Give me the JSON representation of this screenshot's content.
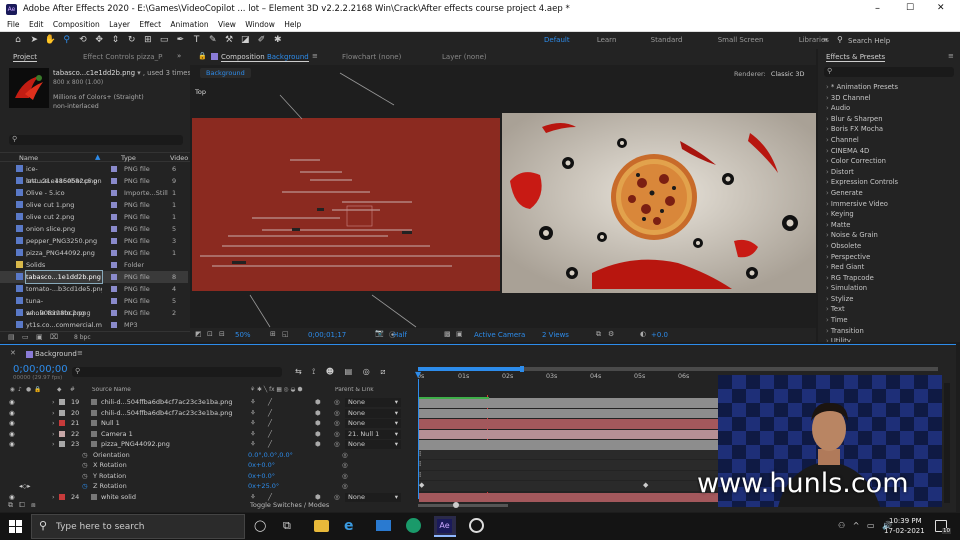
{
  "window": {
    "title": "Adobe After Effects 2020 - E:\\Games\\VideoCopilot ... lot – Element 3D v2.2.2.2168 Win\\Crack\\After effects course project 4.aep *",
    "controls": [
      "–",
      "☐",
      "✕"
    ]
  },
  "menu": [
    "File",
    "Edit",
    "Composition",
    "Layer",
    "Effect",
    "Animation",
    "View",
    "Window",
    "Help"
  ],
  "workspaces": {
    "items": [
      "Default",
      "Learn",
      "Standard",
      "Small Screen",
      "Libraries"
    ],
    "active": "Default",
    "more": "»",
    "search_placeholder": "Search Help"
  },
  "project_panel": {
    "tab": "Project",
    "effect_controls_tab": "Effect Controls pizza_PNG",
    "selected_name": "tabasco...c1e1dd2b.png",
    "used": ", used 3 times",
    "dims": "800 x 800 (1.00)",
    "colors": "Millions of Colors+ (Straight)",
    "interlace": "non-interlaced",
    "columns": {
      "name": "Name",
      "type": "Type",
      "video": "Video"
    },
    "items": [
      {
        "name": "ice-cre...21e186eb8c.png",
        "type": "PNG file",
        "extra": "6",
        "color": "#5a79c7"
      },
      {
        "name": "lettuce...41505a2c6.png",
        "type": "PNG file",
        "extra": "9",
        "color": "#5a79c7"
      },
      {
        "name": "Olive - 5.ico",
        "type": "Importe...Still",
        "extra": "1",
        "color": "#5a79c7"
      },
      {
        "name": "olive cut 1.png",
        "type": "PNG file",
        "extra": "1",
        "color": "#5a79c7"
      },
      {
        "name": "olive cut 2.png",
        "type": "PNG file",
        "extra": "1",
        "color": "#5a79c7"
      },
      {
        "name": "onion slice.png",
        "type": "PNG file",
        "extra": "5",
        "color": "#5a79c7"
      },
      {
        "name": "pepper_PNG3250.png",
        "type": "PNG file",
        "extra": "3",
        "color": "#5a79c7"
      },
      {
        "name": "pizza_PNG44092.png",
        "type": "PNG file",
        "extra": "1",
        "color": "#5a79c7"
      },
      {
        "name": "Solids",
        "type": "Folder",
        "extra": "",
        "color": "#d8b84a"
      },
      {
        "name": "tabasco...1e1dd2b.png",
        "type": "PNG file",
        "extra": "8",
        "color": "#5a79c7"
      },
      {
        "name": "tomato-...b3cd1de5.png",
        "type": "PNG file",
        "extra": "4",
        "color": "#5a79c7"
      },
      {
        "name": "tuna-sa...908128bc2.png",
        "type": "PNG file",
        "extra": "5",
        "color": "#5a79c7"
      },
      {
        "name": "whole tomato.png",
        "type": "PNG file",
        "extra": "2",
        "color": "#5a79c7"
      },
      {
        "name": "yt1s.co...commercial.mp3",
        "type": "MP3",
        "extra": "",
        "color": "#5a79c7"
      }
    ],
    "bpc": "8 bpc"
  },
  "composition_panel": {
    "tab": "Composition",
    "tab_name": "Background",
    "flowchart": "Flowchart (none)",
    "layer": "Layer (none)",
    "breadcrumb": "Background",
    "renderer_label": "Renderer:",
    "renderer_value": "Classic 3D",
    "view_label": "Top",
    "zoom": "50%",
    "timecode": "0;00;01;17",
    "resolution": "Half",
    "camera": "Active Camera",
    "views": "2 Views",
    "exposure": "+0.0"
  },
  "effects_panel": {
    "tab": "Effects & Presets",
    "items": [
      "* Animation Presets",
      "3D Channel",
      "Audio",
      "Blur & Sharpen",
      "Boris FX Mocha",
      "Channel",
      "CINEMA 4D",
      "Color Correction",
      "Distort",
      "Expression Controls",
      "Generate",
      "Immersive Video",
      "Keying",
      "Matte",
      "Noise & Grain",
      "Obsolete",
      "Perspective",
      "Red Giant",
      "RG Trapcode",
      "Simulation",
      "Stylize",
      "Text",
      "Time",
      "Transition",
      "Utility"
    ]
  },
  "timeline": {
    "tab": "Background",
    "timecode": "0;00;00;00",
    "fps": "00000 (29.97 fps)",
    "col_source": "Source Name",
    "col_parent": "Parent & Link",
    "layers": [
      {
        "num": "19",
        "name": "chili-d...504ffba6db4cf7ac23c3e1ba.png",
        "parent": "None",
        "color": "#a8a8a8"
      },
      {
        "num": "20",
        "name": "chili-d...504ffba6db4cf7ac23c3e1ba.png",
        "parent": "None",
        "color": "#a8a8a8"
      },
      {
        "num": "21",
        "name": "Null 1",
        "parent": "None",
        "color": "#c73b3b"
      },
      {
        "num": "22",
        "name": "Camera 1",
        "parent": "21. Null 1",
        "color": "#c7a7a7"
      },
      {
        "num": "23",
        "name": "pizza_PNG44092.png",
        "parent": "None",
        "color": "#a8a8a8"
      }
    ],
    "props": [
      {
        "name": "Orientation",
        "value": "0.0°,0.0°,0.0°"
      },
      {
        "name": "X Rotation",
        "value": "0x+0.0°"
      },
      {
        "name": "Y Rotation",
        "value": "0x+0.0°"
      },
      {
        "name": "Z Rotation",
        "value": "0x+25.0°"
      }
    ],
    "last_layer": {
      "num": "24",
      "name": "white solid",
      "parent": "None",
      "color": "#c73b3b"
    },
    "ticks": [
      "0s",
      "01s",
      "02s",
      "03s",
      "04s",
      "05s",
      "06s"
    ],
    "toggle_label": "Toggle Switches / Modes"
  },
  "watermark": "www.hunls.com",
  "taskbar": {
    "search_placeholder": "Type here to search",
    "time": "10:39 PM",
    "date": "17-02-2021",
    "notif": "10"
  },
  "colors": {
    "accent": "#2d8ceb",
    "comp_bg": "#8b2a20",
    "selected_row": "#3a3a3a",
    "playhead": "#d33"
  }
}
